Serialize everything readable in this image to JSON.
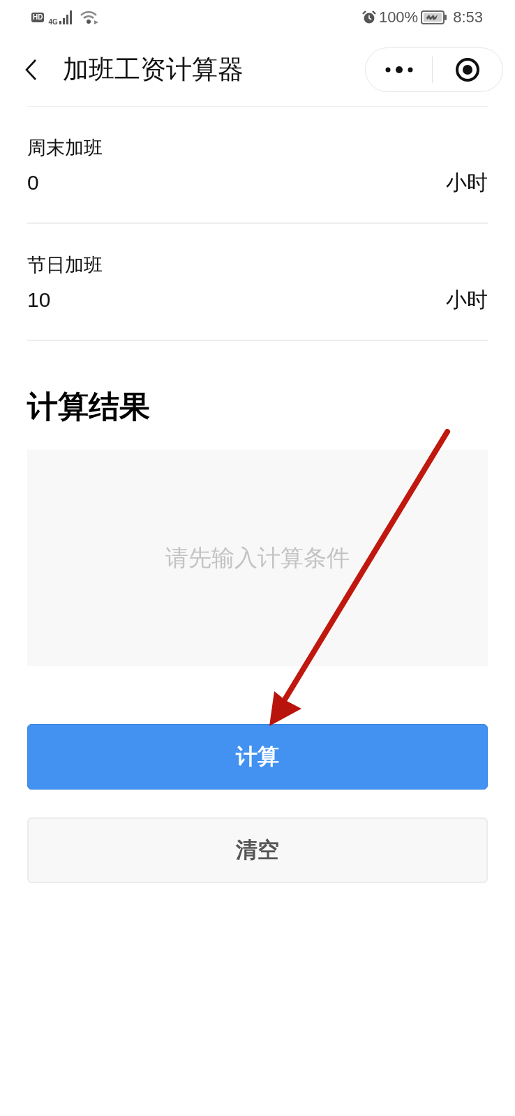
{
  "status_bar": {
    "hd": "HD",
    "network": "4G",
    "battery": "100%",
    "time": "8:53"
  },
  "nav_bar": {
    "title": "加班工资计算器"
  },
  "fields": [
    {
      "label": "周末加班",
      "value": "0",
      "unit": "小时"
    },
    {
      "label": "节日加班",
      "value": "10",
      "unit": "小时"
    }
  ],
  "result": {
    "heading": "计算结果",
    "empty_message": "请先输入计算条件"
  },
  "buttons": [
    {
      "label": "计算",
      "kind": "primary"
    },
    {
      "label": "清空",
      "kind": "secondary"
    }
  ]
}
